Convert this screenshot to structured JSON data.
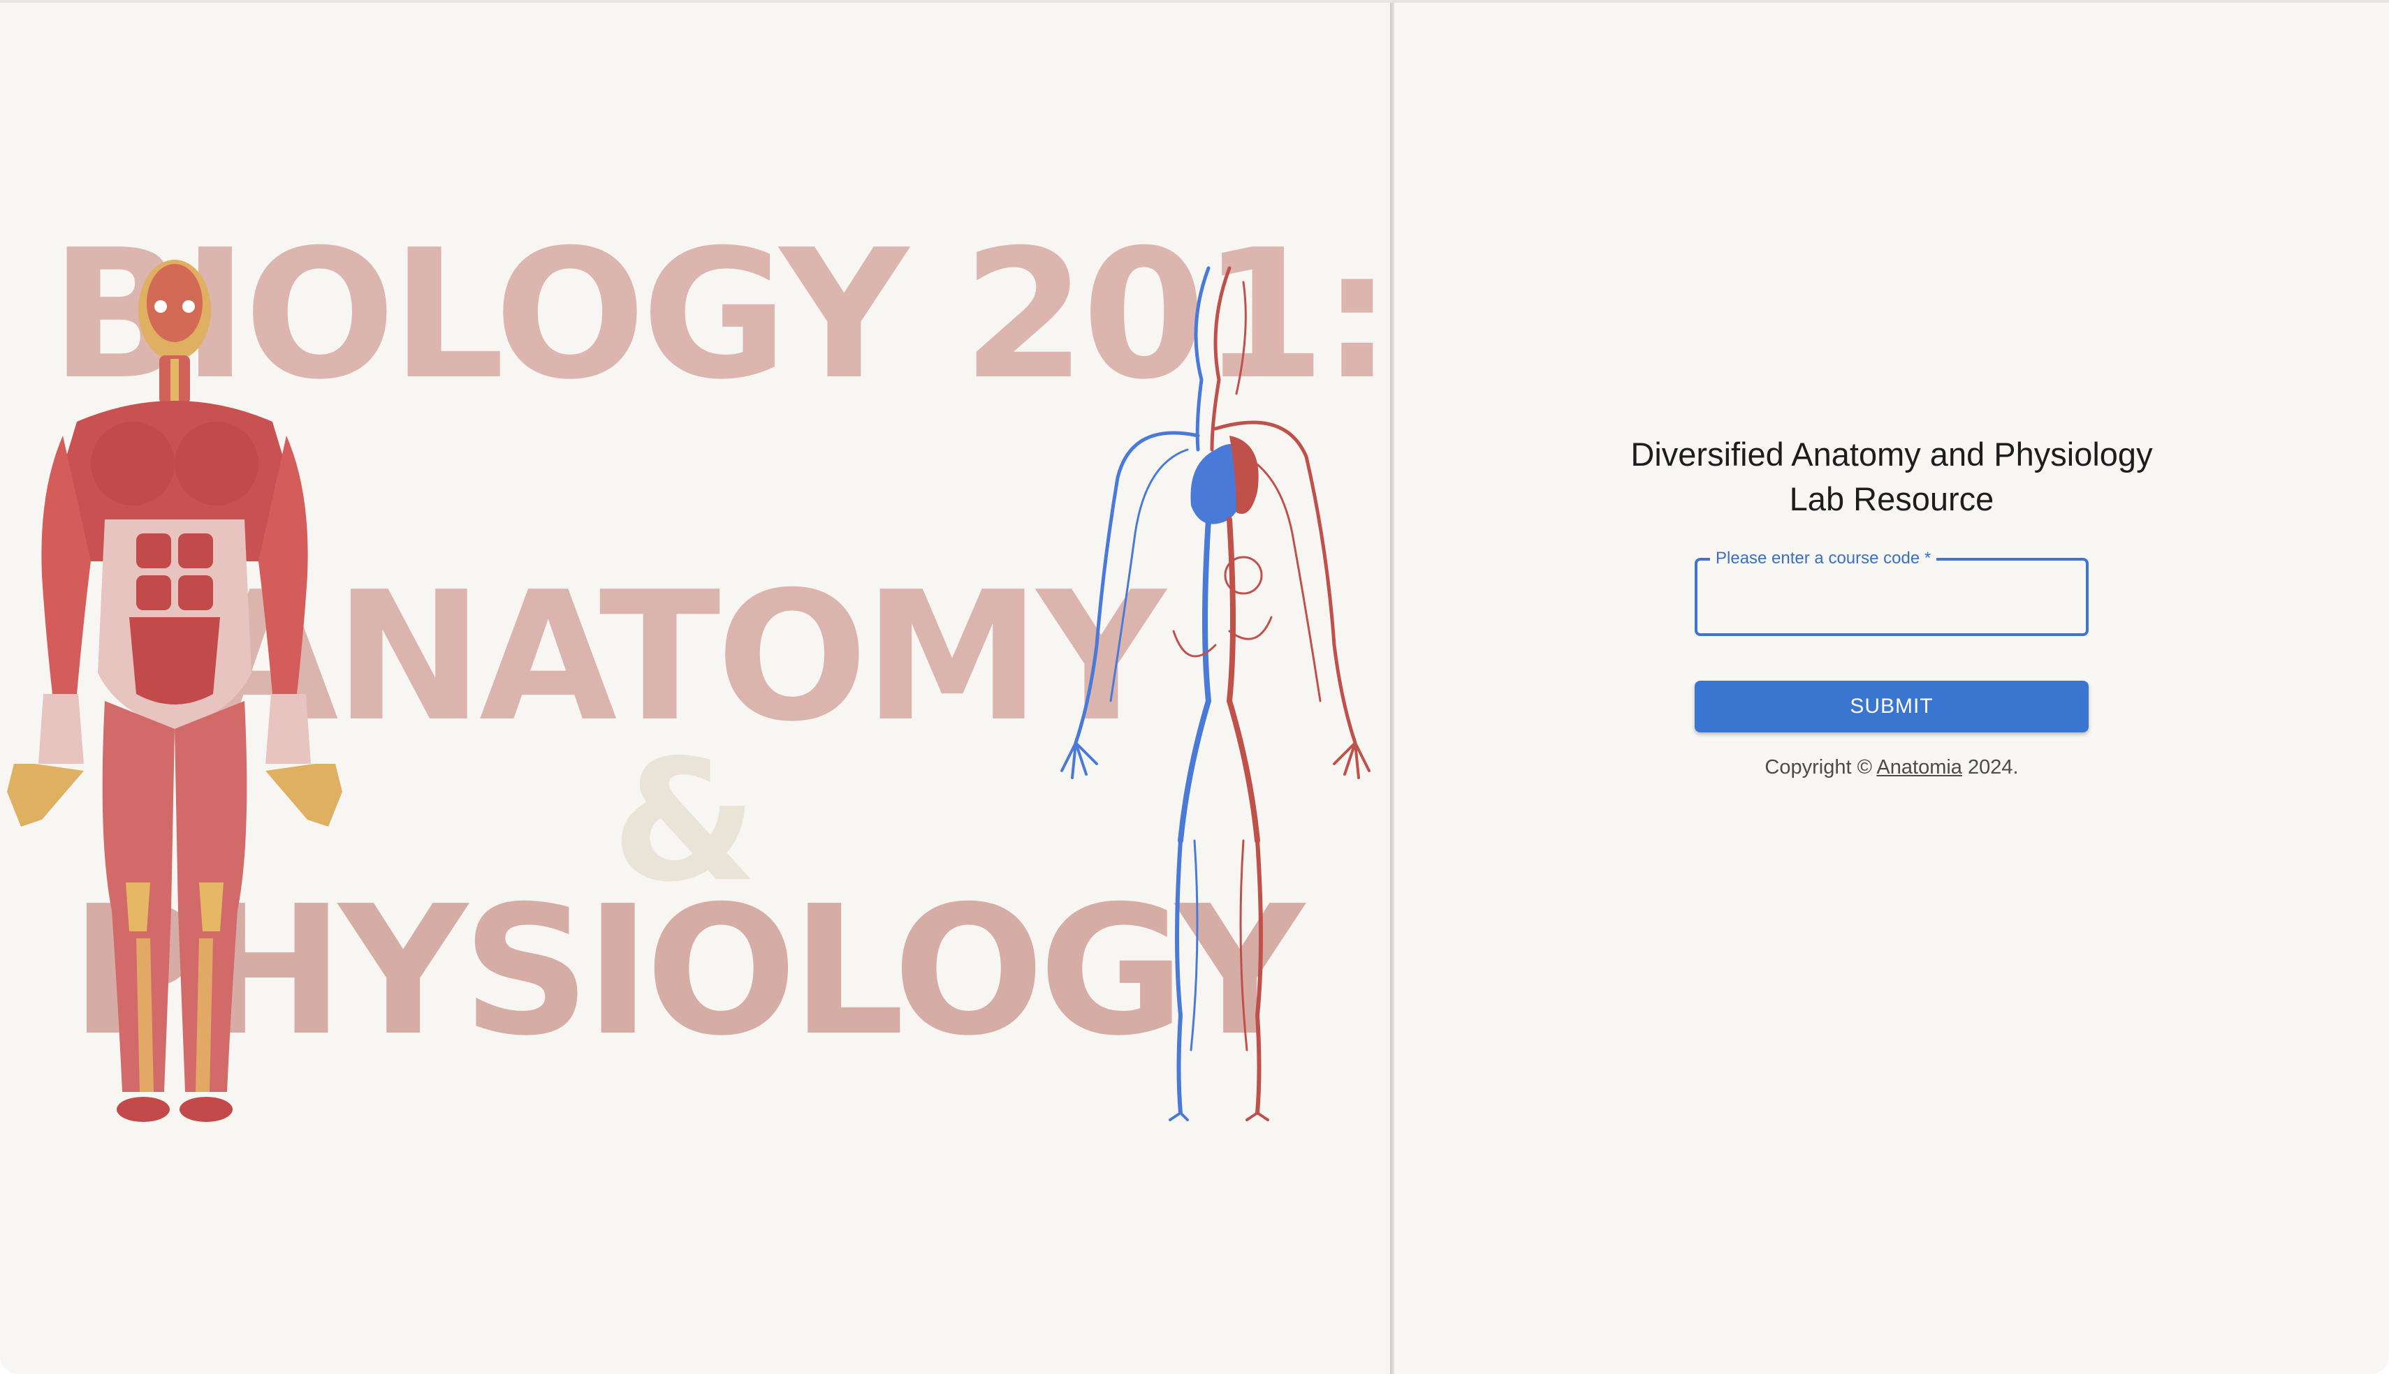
{
  "hero": {
    "line1": "BIOLOGY 201:",
    "line2": "ANATOMY",
    "line3": "&",
    "line4": "PHYSIOLOGY"
  },
  "form": {
    "title_line1": "Diversified Anatomy and Physiology",
    "title_line2": "Lab Resource",
    "course_code_label": "Please enter a course code *",
    "course_code_value": "",
    "submit_label": "SUBMIT"
  },
  "footer": {
    "copyright_prefix": "Copyright ©",
    "brand_link": "Anatomia",
    "copyright_suffix": "2024."
  },
  "colors": {
    "primary": "#3a75d0",
    "muscle_red": "#c95555",
    "vein_blue": "#4a7ad8",
    "artery_red": "#c0504a",
    "background": "#f9f7f4"
  }
}
